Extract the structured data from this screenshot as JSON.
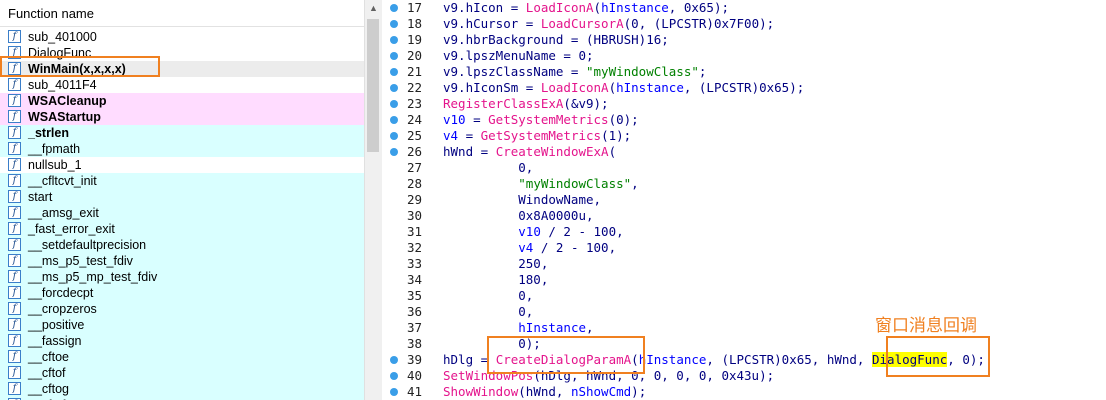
{
  "function_list": {
    "header": "Function name",
    "icon_glyph": "f",
    "items": [
      {
        "name": "sub_401000",
        "bg": "#ffffff",
        "bold": false
      },
      {
        "name": "DialogFunc",
        "bg": "#ffffff",
        "bold": false
      },
      {
        "name": "WinMain(x,x,x,x)",
        "bg": "#ececec",
        "bold": true
      },
      {
        "name": "sub_4011F4",
        "bg": "#ffffff",
        "bold": false
      },
      {
        "name": "WSACleanup",
        "bg": "#ffdcff",
        "bold": true
      },
      {
        "name": "WSAStartup",
        "bg": "#ffdcff",
        "bold": true
      },
      {
        "name": "_strlen",
        "bg": "#d9ffff",
        "bold": true
      },
      {
        "name": "__fpmath",
        "bg": "#d9ffff",
        "bold": false
      },
      {
        "name": "nullsub_1",
        "bg": "#ffffff",
        "bold": false
      },
      {
        "name": "__cfltcvt_init",
        "bg": "#d9ffff",
        "bold": false
      },
      {
        "name": "start",
        "bg": "#d9ffff",
        "bold": false
      },
      {
        "name": "__amsg_exit",
        "bg": "#d9ffff",
        "bold": false
      },
      {
        "name": "_fast_error_exit",
        "bg": "#d9ffff",
        "bold": false
      },
      {
        "name": "__setdefaultprecision",
        "bg": "#d9ffff",
        "bold": false
      },
      {
        "name": "__ms_p5_test_fdiv",
        "bg": "#d9ffff",
        "bold": false
      },
      {
        "name": "__ms_p5_mp_test_fdiv",
        "bg": "#d9ffff",
        "bold": false
      },
      {
        "name": "__forcdecpt",
        "bg": "#d9ffff",
        "bold": false
      },
      {
        "name": "__cropzeros",
        "bg": "#d9ffff",
        "bold": false
      },
      {
        "name": "__positive",
        "bg": "#d9ffff",
        "bold": false
      },
      {
        "name": "__fassign",
        "bg": "#d9ffff",
        "bold": false
      },
      {
        "name": "__cftoe",
        "bg": "#d9ffff",
        "bold": false
      },
      {
        "name": "__cftof",
        "bg": "#d9ffff",
        "bold": false
      },
      {
        "name": "__cftog",
        "bg": "#d9ffff",
        "bold": false
      },
      {
        "name": "__cftofp",
        "bg": "#d9ffff",
        "bold": false
      }
    ]
  },
  "code": {
    "lines": [
      {
        "num": "17",
        "dot": true,
        "tokens": [
          [
            "v9.hIcon = ",
            "plain"
          ],
          [
            "LoadIconA",
            "fn"
          ],
          [
            "(",
            "plain"
          ],
          [
            "hInstance",
            "var"
          ],
          [
            ", 0x65);",
            "plain"
          ]
        ]
      },
      {
        "num": "18",
        "dot": true,
        "tokens": [
          [
            "v9.hCursor = ",
            "plain"
          ],
          [
            "LoadCursorA",
            "fn"
          ],
          [
            "(0, (LPCSTR)0x7F00);",
            "plain"
          ]
        ]
      },
      {
        "num": "19",
        "dot": true,
        "tokens": [
          [
            "v9.hbrBackground = (HBRUSH)16;",
            "plain"
          ]
        ]
      },
      {
        "num": "20",
        "dot": true,
        "tokens": [
          [
            "v9.lpszMenuName = 0;",
            "plain"
          ]
        ]
      },
      {
        "num": "21",
        "dot": true,
        "tokens": [
          [
            "v9.lpszClassName = ",
            "plain"
          ],
          [
            "\"myWindowClass\"",
            "str"
          ],
          [
            ";",
            "plain"
          ]
        ]
      },
      {
        "num": "22",
        "dot": true,
        "tokens": [
          [
            "v9.hIconSm = ",
            "plain"
          ],
          [
            "LoadIconA",
            "fn"
          ],
          [
            "(",
            "plain"
          ],
          [
            "hInstance",
            "var"
          ],
          [
            ", (LPCSTR)0x65);",
            "plain"
          ]
        ]
      },
      {
        "num": "23",
        "dot": true,
        "tokens": [
          [
            "RegisterClassExA",
            "fn"
          ],
          [
            "(&v9);",
            "plain"
          ]
        ]
      },
      {
        "num": "24",
        "dot": true,
        "tokens": [
          [
            "v10",
            "var"
          ],
          [
            " = ",
            "plain"
          ],
          [
            "GetSystemMetrics",
            "fn"
          ],
          [
            "(0);",
            "plain"
          ]
        ]
      },
      {
        "num": "25",
        "dot": true,
        "tokens": [
          [
            "v4",
            "var"
          ],
          [
            " = ",
            "plain"
          ],
          [
            "GetSystemMetrics",
            "fn"
          ],
          [
            "(1);",
            "plain"
          ]
        ]
      },
      {
        "num": "26",
        "dot": true,
        "tokens": [
          [
            "hWnd = ",
            "plain"
          ],
          [
            "CreateWindowExA",
            "fn"
          ],
          [
            "(",
            "plain"
          ]
        ]
      },
      {
        "num": "27",
        "dot": false,
        "tokens": [
          [
            "          0,",
            "plain"
          ]
        ]
      },
      {
        "num": "28",
        "dot": false,
        "tokens": [
          [
            "          ",
            "plain"
          ],
          [
            "\"myWindowClass\"",
            "str"
          ],
          [
            ",",
            "plain"
          ]
        ]
      },
      {
        "num": "29",
        "dot": false,
        "tokens": [
          [
            "          WindowName,",
            "plain"
          ]
        ]
      },
      {
        "num": "30",
        "dot": false,
        "tokens": [
          [
            "          0x8A0000u,",
            "plain"
          ]
        ]
      },
      {
        "num": "31",
        "dot": false,
        "tokens": [
          [
            "          ",
            "plain"
          ],
          [
            "v10",
            "var"
          ],
          [
            " / 2 - 100,",
            "plain"
          ]
        ]
      },
      {
        "num": "32",
        "dot": false,
        "tokens": [
          [
            "          ",
            "plain"
          ],
          [
            "v4",
            "var"
          ],
          [
            " / 2 - 100,",
            "plain"
          ]
        ]
      },
      {
        "num": "33",
        "dot": false,
        "tokens": [
          [
            "          250,",
            "plain"
          ]
        ]
      },
      {
        "num": "34",
        "dot": false,
        "tokens": [
          [
            "          180,",
            "plain"
          ]
        ]
      },
      {
        "num": "35",
        "dot": false,
        "tokens": [
          [
            "          0,",
            "plain"
          ]
        ]
      },
      {
        "num": "36",
        "dot": false,
        "tokens": [
          [
            "          0,",
            "plain"
          ]
        ]
      },
      {
        "num": "37",
        "dot": false,
        "tokens": [
          [
            "          ",
            "plain"
          ],
          [
            "hInstance",
            "var"
          ],
          [
            ",",
            "plain"
          ]
        ]
      },
      {
        "num": "38",
        "dot": false,
        "tokens": [
          [
            "          0);",
            "plain"
          ]
        ]
      },
      {
        "num": "39",
        "dot": true,
        "tokens": [
          [
            "hDlg = ",
            "plain"
          ],
          [
            "CreateDialogParamA",
            "fn"
          ],
          [
            "(",
            "plain"
          ],
          [
            "hInstance",
            "var"
          ],
          [
            ", (LPCSTR)0x65, hWnd, ",
            "plain"
          ],
          [
            "DialogFunc",
            "hl"
          ],
          [
            ", 0);",
            "plain"
          ]
        ]
      },
      {
        "num": "40",
        "dot": true,
        "tokens": [
          [
            "SetWindowPos",
            "fn"
          ],
          [
            "(hDlg, hWnd, 0, 0, 0, 0, 0x43u);",
            "plain"
          ]
        ]
      },
      {
        "num": "41",
        "dot": true,
        "tokens": [
          [
            "ShowWindow",
            "fn"
          ],
          [
            "(hWnd, ",
            "plain"
          ],
          [
            "nShowCmd",
            "var"
          ],
          [
            ");",
            "plain"
          ]
        ]
      }
    ]
  },
  "annotation": {
    "note": "窗口消息回调"
  },
  "colors": {
    "accent_orange": "#f08020",
    "breakpoint_blue": "#3a9ee8",
    "function_pink": "#e4148c",
    "library_cyan": "#d9ffff",
    "import_pink": "#ffdcff"
  }
}
